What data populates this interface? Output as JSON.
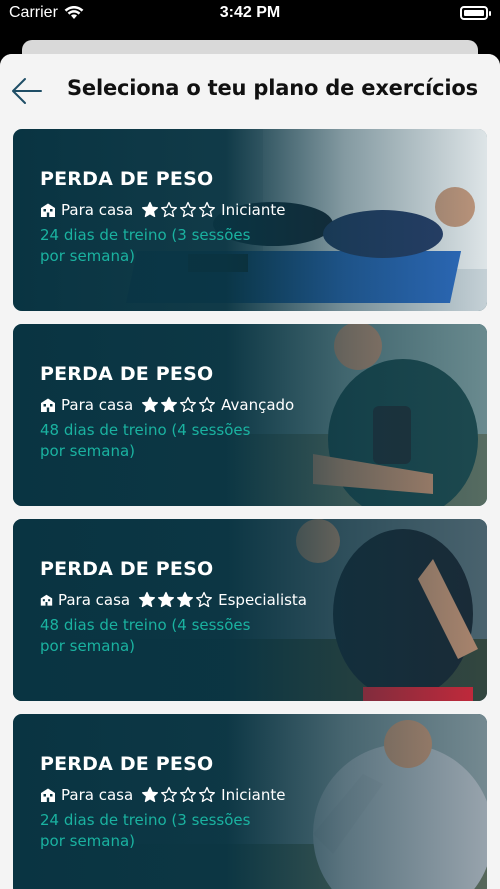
{
  "status_bar": {
    "carrier": "Carrier",
    "time": "3:42 PM"
  },
  "header": {
    "title": "Seleciona o teu plano de exercícios"
  },
  "colors": {
    "card_bg": "#093442",
    "accent_teal": "#1ab2a0",
    "title_text": "#111111"
  },
  "plans": [
    {
      "title": "PERDA DE PESO",
      "location": "Para casa",
      "rating": 1,
      "max_rating": 4,
      "level": "Iniciante",
      "duration": "24 dias de treino (3 sessões por semana)",
      "image": "woman-doing-crunches"
    },
    {
      "title": "PERDA DE PESO",
      "location": "Para casa",
      "rating": 2,
      "max_rating": 4,
      "level": "Avançado",
      "duration": "48 dias de treino (4 sessões por semana)",
      "image": "man-running-armband"
    },
    {
      "title": "PERDA DE PESO",
      "location": "Para casa",
      "rating": 3,
      "max_rating": 4,
      "level": "Especialista",
      "duration": "48 dias de treino (4 sessões por semana)",
      "image": "man-sprinting"
    },
    {
      "title": "PERDA DE PESO",
      "location": "Para casa",
      "rating": 1,
      "max_rating": 4,
      "level": "Iniciante",
      "duration": "24 dias de treino (3 sessões por semana)",
      "image": "man-jogging-outdoors"
    }
  ]
}
